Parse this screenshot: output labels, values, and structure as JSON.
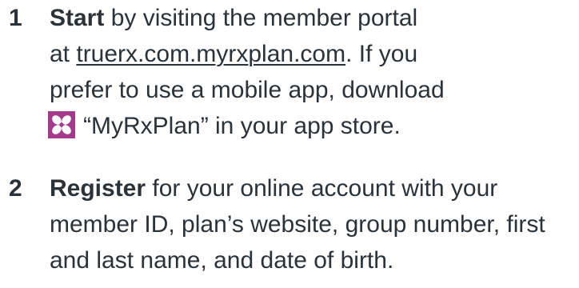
{
  "steps": [
    {
      "number": "1",
      "lead": "Start",
      "line1_rest": " by visiting the member portal",
      "line2_prefix": "at ",
      "link": "truerx.com.myrxplan.com",
      "line2_suffix": ". If you",
      "line3": "prefer to use a mobile app, download",
      "app_icon": "myrxplan-app-icon",
      "app_icon_color": "#a33a8c",
      "line4": "“MyRxPlan” in your app store."
    },
    {
      "number": "2",
      "lead": "Register",
      "line1_rest": " for your online account with your",
      "line2": "member ID, plan’s website, group number, first",
      "line3": "and last name, and date of birth."
    }
  ]
}
